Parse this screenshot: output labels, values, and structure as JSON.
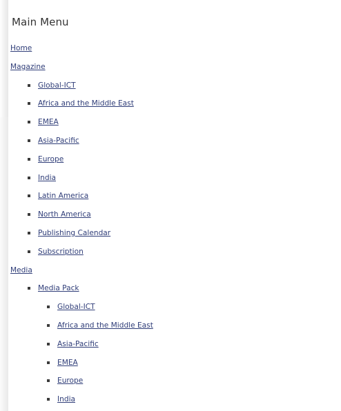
{
  "main_menu": {
    "title": "Main Menu",
    "items": [
      {
        "label": "Home",
        "level": 0
      },
      {
        "label": "Magazine",
        "level": 0
      },
      {
        "label": "Global-ICT",
        "level": 1
      },
      {
        "label": "Africa and the Middle East",
        "level": 1
      },
      {
        "label": "EMEA",
        "level": 1
      },
      {
        "label": "Asia-Pacific",
        "level": 1
      },
      {
        "label": "Europe",
        "level": 1
      },
      {
        "label": "India",
        "level": 1
      },
      {
        "label": "Latin America",
        "level": 1
      },
      {
        "label": "North America",
        "level": 1
      },
      {
        "label": "Publishing Calendar",
        "level": 1
      },
      {
        "label": "Subscription",
        "level": 1
      },
      {
        "label": "Media",
        "level": 0
      },
      {
        "label": "Media Pack",
        "level": 1
      },
      {
        "label": "Global-ICT",
        "level": 2
      },
      {
        "label": "Africa and the Middle East",
        "level": 2
      },
      {
        "label": "Asia-Pacific",
        "level": 2
      },
      {
        "label": "EMEA",
        "level": 2
      },
      {
        "label": "Europe",
        "level": 2
      },
      {
        "label": "India",
        "level": 2
      }
    ]
  }
}
